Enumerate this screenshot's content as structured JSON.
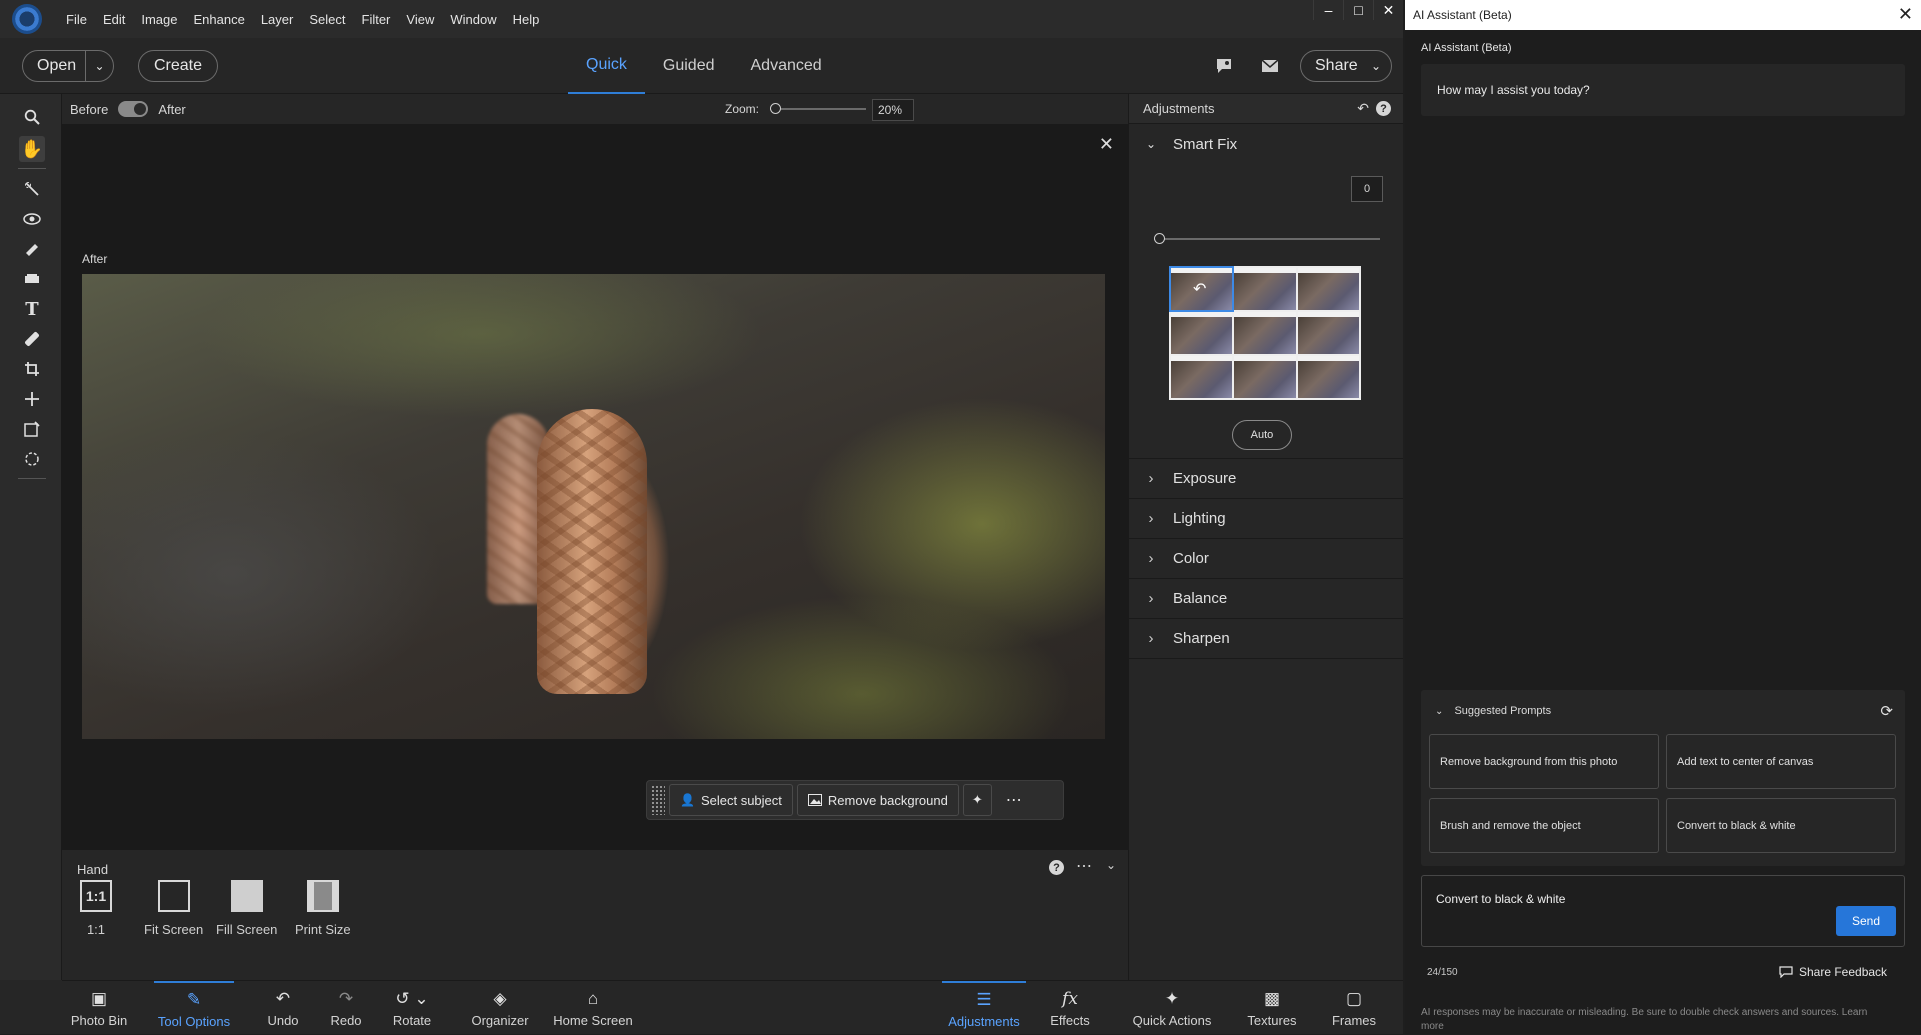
{
  "menubar": {
    "items": [
      "File",
      "Edit",
      "Image",
      "Enhance",
      "Layer",
      "Select",
      "Filter",
      "View",
      "Window",
      "Help"
    ],
    "window_controls": [
      "–",
      "□",
      "✕"
    ]
  },
  "toolbar": {
    "open_label": "Open",
    "create_label": "Create",
    "tabs": [
      {
        "label": "Quick",
        "active": true
      },
      {
        "label": "Guided",
        "active": false
      },
      {
        "label": "Advanced",
        "active": false
      }
    ],
    "share_label": "Share"
  },
  "canvas": {
    "before_label": "Before",
    "after_label": "After",
    "zoom_label": "Zoom:",
    "zoom_value": "20%",
    "zoom_level": 0.2,
    "image_label": "After",
    "quick_actions": {
      "select_subject": "Select subject",
      "remove_background": "Remove background"
    }
  },
  "tool_options": {
    "title": "Hand",
    "items": [
      {
        "label": "1:1",
        "icon": "one-to-one-icon"
      },
      {
        "label": "Fit Screen",
        "icon": "fit-screen-icon"
      },
      {
        "label": "Fill Screen",
        "icon": "fill-screen-icon"
      },
      {
        "label": "Print Size",
        "icon": "print-size-icon"
      }
    ],
    "one_to_one_glyph": "1:1"
  },
  "adjustments": {
    "title": "Adjustments",
    "smart_fix": {
      "label": "Smart Fix",
      "value": "0",
      "auto_label": "Auto"
    },
    "sections": [
      "Exposure",
      "Lighting",
      "Color",
      "Balance",
      "Sharpen"
    ]
  },
  "bottombar": {
    "items": [
      {
        "label": "Photo Bin",
        "icon": "photo-bin-icon",
        "active": false
      },
      {
        "label": "Tool Options",
        "icon": "tool-options-icon",
        "active": true
      },
      {
        "label": "Undo",
        "icon": "undo-icon",
        "active": false
      },
      {
        "label": "Redo",
        "icon": "redo-icon",
        "active": false
      },
      {
        "label": "Rotate",
        "icon": "rotate-icon",
        "active": false
      },
      {
        "label": "Organizer",
        "icon": "organizer-icon",
        "active": false
      },
      {
        "label": "Home Screen",
        "icon": "home-icon",
        "active": false
      },
      {
        "label": "Adjustments",
        "icon": "adjustments-icon",
        "active": true
      },
      {
        "label": "Effects",
        "icon": "effects-icon",
        "active": false
      },
      {
        "label": "Quick Actions",
        "icon": "sparkle-icon",
        "active": false
      },
      {
        "label": "Textures",
        "icon": "textures-icon",
        "active": false
      },
      {
        "label": "Frames",
        "icon": "frames-icon",
        "active": false
      }
    ]
  },
  "ai_assistant": {
    "window_title": "AI Assistant (Beta)",
    "header": "AI Assistant (Beta)",
    "greeting": "How may I assist you today?",
    "suggested_title": "Suggested Prompts",
    "prompts": [
      "Remove background from this photo",
      "Add text to center of canvas",
      "Brush and remove the object",
      "Convert to black & white"
    ],
    "input_value": "Convert to black & white",
    "send_label": "Send",
    "counter": "24/150",
    "feedback_label": "Share Feedback",
    "disclaimer": "AI responses may be inaccurate or misleading. Be sure to double check answers and sources. Learn more"
  },
  "colors": {
    "accent": "#2f7ed8",
    "panel_bg": "#262626",
    "send_button": "#2676d9"
  }
}
